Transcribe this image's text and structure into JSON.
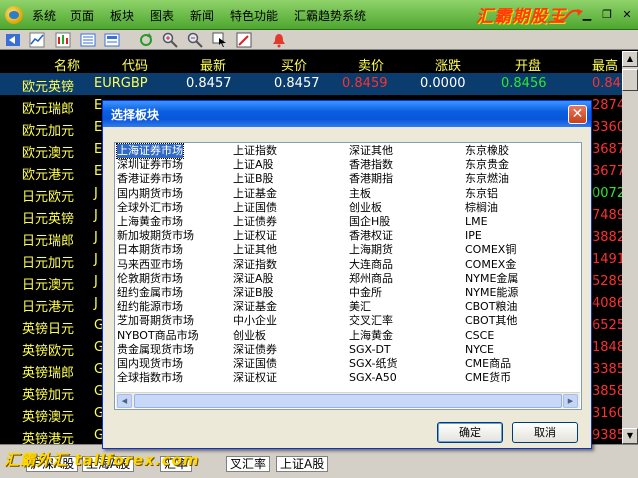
{
  "menubar": {
    "items": [
      "系统",
      "页面",
      "板块",
      "图表",
      "新闻",
      "特色功能",
      "汇霸趋势系统"
    ],
    "brand": "汇霸期股王"
  },
  "quote_table": {
    "headers": [
      "名称",
      "代码",
      "最新",
      "买价",
      "卖价",
      "涨跌",
      "开盘",
      "最高"
    ],
    "selected_row": {
      "name": "欧元英镑",
      "code": "EURGBP",
      "last": "0.8457",
      "bid": "0.8457",
      "ask": "0.8459",
      "change": "0.0000",
      "open": "0.8456",
      "high": "0.8472"
    },
    "rows": [
      {
        "name": "欧元瑞郎",
        "code": "E",
        "high": "2874"
      },
      {
        "name": "欧元加元",
        "code": "E",
        "high": "3360"
      },
      {
        "name": "欧元澳元",
        "code": "E",
        "high": "3687"
      },
      {
        "name": "欧元港元",
        "code": "E",
        "high": "3677"
      },
      {
        "name": "日元欧元",
        "code": "J",
        "high": "0072"
      },
      {
        "name": "日元英镑",
        "code": "J",
        "high": "7489"
      },
      {
        "name": "日元瑞郎",
        "code": "J",
        "high": "3882"
      },
      {
        "name": "日元加元",
        "code": "J",
        "high": "1491"
      },
      {
        "name": "日元澳元",
        "code": "J",
        "high": "5289"
      },
      {
        "name": "日元港元",
        "code": "J",
        "high": "4086"
      },
      {
        "name": "英镑日元",
        "code": "G",
        "high": "6525"
      },
      {
        "name": "英镑欧元",
        "code": "G",
        "high": "1848"
      },
      {
        "name": "英镑瑞郎",
        "code": "G",
        "high": "3385"
      },
      {
        "name": "英镑加元",
        "code": "G",
        "high": "3858"
      },
      {
        "name": "英镑澳元",
        "code": "G",
        "high": "3160"
      },
      {
        "name": "英镑港元",
        "code": "G",
        "high": "9385"
      }
    ]
  },
  "dialog": {
    "title": "选择板块",
    "columns": [
      [
        "上海证券市场",
        "深圳证券市场",
        "香港证券市场",
        "国内期货市场",
        "全球外汇市场",
        "上海黄金市场",
        "新加坡期货市场",
        "日本期货市场",
        "马来西亚市场",
        "伦敦期货市场",
        "纽约金属市场",
        "纽约能源市场",
        "芝加哥期货市场",
        "NYBOT商品市场",
        "贵金属现货市场",
        "国内现货市场",
        "全球指数市场"
      ],
      [
        "上证指数",
        "上证A股",
        "上证B股",
        "上证基金",
        "上证国债",
        "上证债券",
        "上证权证",
        "上证其他",
        "深证指数",
        "深证A股",
        "深证B股",
        "深证基金",
        "中小企业",
        "创业板",
        "深证债券",
        "深证国债",
        "深证权证"
      ],
      [
        "深证其他",
        "香港指数",
        "香港期指",
        "主板",
        "创业板",
        "国企H股",
        "香港权证",
        "上海期货",
        "大连商品",
        "郑州商品",
        "中金所",
        "美汇",
        "交叉汇率",
        "上海黄金",
        "SGX-DT",
        "SGX-纸货",
        "SGX-A50"
      ],
      [
        "东京橡胶",
        "东京贵金",
        "东京燃油",
        "东京铝",
        "棕榈油",
        "LME",
        "IPE",
        "COMEX铜",
        "COMEX金",
        "NYME金属",
        "NYME能源",
        "CBOT粮油",
        "CBOT其他",
        "CSCE",
        "NYCE",
        "CME商品",
        "CME货币"
      ]
    ],
    "selected": "上海证券市场",
    "ok_label": "确定",
    "cancel_label": "取消"
  },
  "bottom_tabs": {
    "watermark": "汇霸外汇 tallforex.com",
    "tabs": [
      "沪深A股",
      "上海A股",
      "汇率",
      "叉汇率",
      "上证A股"
    ]
  }
}
